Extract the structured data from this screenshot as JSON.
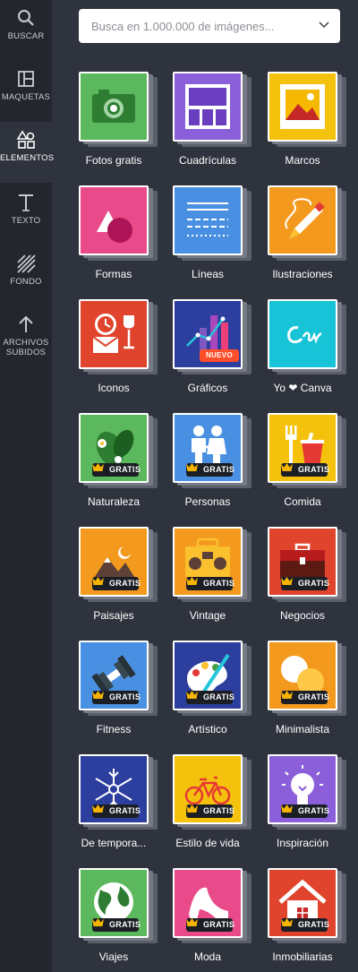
{
  "sidebar": {
    "items": [
      {
        "label": "BUSCAR",
        "icon": "search-icon",
        "active": false
      },
      {
        "label": "MAQUETAS",
        "icon": "layout-icon",
        "active": false
      },
      {
        "label": "ELEMENTOS",
        "icon": "shapes-icon",
        "active": true
      },
      {
        "label": "TEXTO",
        "icon": "text-icon",
        "active": false
      },
      {
        "label": "FONDO",
        "icon": "background-icon",
        "active": false
      },
      {
        "label": "ARCHIVOS SUBIDOS",
        "label_lines": [
          "ARCHIVOS",
          "SUBIDOS"
        ],
        "icon": "upload-icon",
        "active": false
      }
    ]
  },
  "search": {
    "placeholder": "Busca en 1.000.000 de imágenes..."
  },
  "badges": {
    "free": "GRATIS",
    "new": "NUEVO"
  },
  "colors": {
    "sidebar": "#23262d",
    "panel": "#2f333d",
    "badge_new": "#ff4e2a",
    "crown": "#f5b400"
  },
  "categories": [
    {
      "label": "Fotos gratis",
      "color": "#5cb85c",
      "icon": "camera-icon",
      "badge": ""
    },
    {
      "label": "Cuadrículas",
      "color": "#8b5fd9",
      "icon": "grid-icon",
      "badge": ""
    },
    {
      "label": "Marcos",
      "color": "#f4c20d",
      "icon": "frame-icon",
      "badge": ""
    },
    {
      "label": "Formas",
      "color": "#e94a8a",
      "icon": "shapes-icon",
      "badge": ""
    },
    {
      "label": "Líneas",
      "color": "#4a90e2",
      "icon": "lines-icon",
      "badge": ""
    },
    {
      "label": "Ilustraciones",
      "color": "#f39a1e",
      "icon": "pencil-icon",
      "badge": ""
    },
    {
      "label": "Iconos",
      "color": "#e0442c",
      "icon": "icons-icon",
      "badge": ""
    },
    {
      "label": "Gráficos",
      "color": "#2c3e9e",
      "icon": "chart-icon",
      "badge": "new"
    },
    {
      "label": "Yo ❤ Canva",
      "color": "#17c3d6",
      "icon": "canva-logo-icon",
      "badge": ""
    },
    {
      "label": "Naturaleza",
      "color": "#5cb85c",
      "icon": "leaf-icon",
      "badge": "free"
    },
    {
      "label": "Personas",
      "color": "#4a90e2",
      "icon": "people-icon",
      "badge": "free"
    },
    {
      "label": "Comida",
      "color": "#f4c20d",
      "icon": "food-icon",
      "badge": "free"
    },
    {
      "label": "Paisajes",
      "color": "#f39a1e",
      "icon": "landscape-icon",
      "badge": "free"
    },
    {
      "label": "Vintage",
      "color": "#f39a1e",
      "icon": "boombox-icon",
      "badge": "free"
    },
    {
      "label": "Negocios",
      "color": "#e0442c",
      "icon": "briefcase-icon",
      "badge": "free"
    },
    {
      "label": "Fitness",
      "color": "#4a90e2",
      "icon": "dumbbell-icon",
      "badge": "free"
    },
    {
      "label": "Artístico",
      "color": "#2c3e9e",
      "icon": "palette-icon",
      "badge": "free"
    },
    {
      "label": "Minimalista",
      "color": "#f39a1e",
      "icon": "circles-icon",
      "badge": "free"
    },
    {
      "label": "De tempora...",
      "color": "#2c3e9e",
      "icon": "snowflake-icon",
      "badge": "free"
    },
    {
      "label": "Estilo de vida",
      "color": "#f4c20d",
      "icon": "bicycle-icon",
      "badge": "free"
    },
    {
      "label": "Inspiración",
      "color": "#8b5fd9",
      "icon": "lightbulb-icon",
      "badge": "free"
    },
    {
      "label": "Viajes",
      "color": "#5cb85c",
      "icon": "globe-icon",
      "badge": "free"
    },
    {
      "label": "Moda",
      "color": "#e94a8a",
      "icon": "heel-icon",
      "badge": "free"
    },
    {
      "label": "Inmobiliarias",
      "color": "#e0442c",
      "icon": "house-icon",
      "badge": "free"
    }
  ]
}
